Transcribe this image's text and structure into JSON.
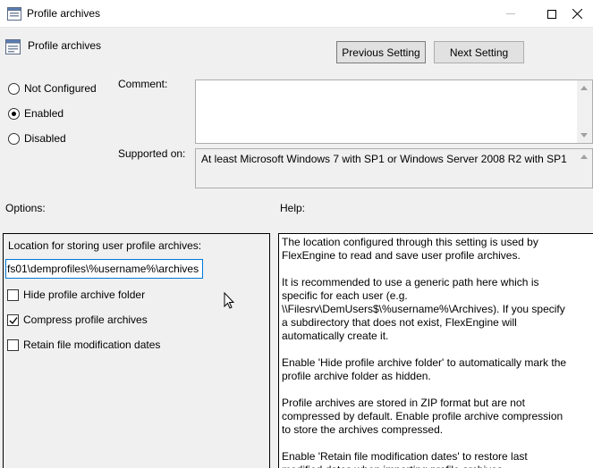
{
  "window": {
    "title": "Profile archives"
  },
  "header": {
    "title": "Profile archives"
  },
  "nav": {
    "previous_label": "Previous Setting",
    "next_label": "Next Setting"
  },
  "state": {
    "options": [
      "Not Configured",
      "Enabled",
      "Disabled"
    ],
    "selected": "Enabled"
  },
  "comment": {
    "label": "Comment:",
    "value": ""
  },
  "supported": {
    "label": "Supported on:",
    "value": "At least Microsoft Windows 7 with SP1 or Windows Server 2008 R2 with SP1"
  },
  "options": {
    "heading": "Options:",
    "location_label": "Location for storing user profile archives:",
    "location_value": "fs01\\demprofiles\\%username%\\archives",
    "checkboxes": [
      {
        "label": "Hide profile archive folder",
        "checked": false
      },
      {
        "label": "Compress profile archives",
        "checked": true
      },
      {
        "label": "Retain file modification dates",
        "checked": false
      }
    ]
  },
  "help": {
    "heading": "Help:",
    "paragraphs": [
      "The location configured through this setting is used by FlexEngine to read and save user profile archives.",
      "It is recommended to use a generic path here which is specific for each user (e.g. \\\\Filesrv\\DemUsers$\\%username%\\Archives). If you specify a subdirectory that does not exist, FlexEngine will automatically create it.",
      "Enable 'Hide profile archive folder' to automatically mark the profile archive folder as hidden.",
      "Profile archives are stored in ZIP format but are not compressed by default. Enable profile archive compression to store the archives compressed.",
      "Enable 'Retain file modification dates' to restore last modified dates when importing profile archives."
    ]
  }
}
